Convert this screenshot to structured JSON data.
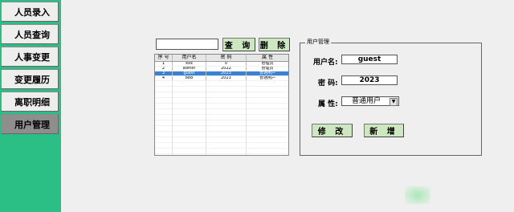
{
  "sidebar": {
    "items": [
      {
        "label": "人员录入"
      },
      {
        "label": "人员查询"
      },
      {
        "label": "人事变更"
      },
      {
        "label": "变更履历"
      },
      {
        "label": "离职明细"
      },
      {
        "label": "用户管理"
      }
    ],
    "active_index": 5
  },
  "search": {
    "value": "",
    "query_label": "查 询",
    "delete_label": "删 除"
  },
  "table": {
    "headers": [
      "序 号",
      "用户名",
      "密 码",
      "属 性"
    ],
    "rows": [
      [
        "1",
        "xxx",
        "0",
        "管理员"
      ],
      [
        "2",
        "admin",
        "2022",
        "管理员"
      ],
      [
        "3",
        "guest",
        "2023",
        "普通用户"
      ],
      [
        "4",
        "888",
        "2023",
        "普通用户"
      ]
    ],
    "selected_row": 2
  },
  "form": {
    "group_title": "用户管理",
    "username_label": "用户名:",
    "username_value": "guest",
    "password_label": "密 码:",
    "password_value": "2023",
    "role_label": "属 性:",
    "role_value": "普通用户",
    "modify_label": "修 改",
    "add_label": "新 增"
  },
  "colors": {
    "sidebar_bg": "#2bbf86",
    "button_bg": "#cde8c1",
    "selected_row": "#3b82d6"
  }
}
